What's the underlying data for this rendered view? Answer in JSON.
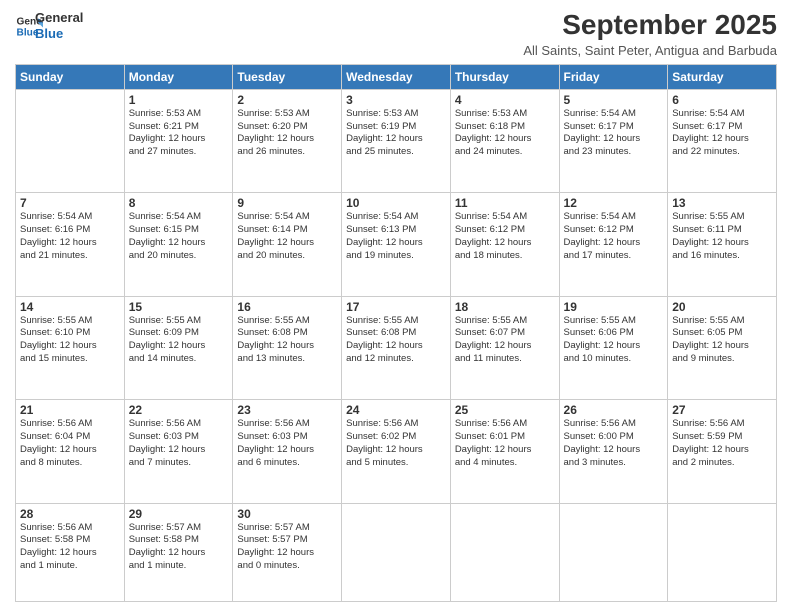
{
  "logo": {
    "line1": "General",
    "line2": "Blue"
  },
  "title": "September 2025",
  "subtitle": "All Saints, Saint Peter, Antigua and Barbuda",
  "days_header": [
    "Sunday",
    "Monday",
    "Tuesday",
    "Wednesday",
    "Thursday",
    "Friday",
    "Saturday"
  ],
  "weeks": [
    [
      {
        "day": "",
        "info": ""
      },
      {
        "day": "1",
        "info": "Sunrise: 5:53 AM\nSunset: 6:21 PM\nDaylight: 12 hours\nand 27 minutes."
      },
      {
        "day": "2",
        "info": "Sunrise: 5:53 AM\nSunset: 6:20 PM\nDaylight: 12 hours\nand 26 minutes."
      },
      {
        "day": "3",
        "info": "Sunrise: 5:53 AM\nSunset: 6:19 PM\nDaylight: 12 hours\nand 25 minutes."
      },
      {
        "day": "4",
        "info": "Sunrise: 5:53 AM\nSunset: 6:18 PM\nDaylight: 12 hours\nand 24 minutes."
      },
      {
        "day": "5",
        "info": "Sunrise: 5:54 AM\nSunset: 6:17 PM\nDaylight: 12 hours\nand 23 minutes."
      },
      {
        "day": "6",
        "info": "Sunrise: 5:54 AM\nSunset: 6:17 PM\nDaylight: 12 hours\nand 22 minutes."
      }
    ],
    [
      {
        "day": "7",
        "info": "Sunrise: 5:54 AM\nSunset: 6:16 PM\nDaylight: 12 hours\nand 21 minutes."
      },
      {
        "day": "8",
        "info": "Sunrise: 5:54 AM\nSunset: 6:15 PM\nDaylight: 12 hours\nand 20 minutes."
      },
      {
        "day": "9",
        "info": "Sunrise: 5:54 AM\nSunset: 6:14 PM\nDaylight: 12 hours\nand 20 minutes."
      },
      {
        "day": "10",
        "info": "Sunrise: 5:54 AM\nSunset: 6:13 PM\nDaylight: 12 hours\nand 19 minutes."
      },
      {
        "day": "11",
        "info": "Sunrise: 5:54 AM\nSunset: 6:12 PM\nDaylight: 12 hours\nand 18 minutes."
      },
      {
        "day": "12",
        "info": "Sunrise: 5:54 AM\nSunset: 6:12 PM\nDaylight: 12 hours\nand 17 minutes."
      },
      {
        "day": "13",
        "info": "Sunrise: 5:55 AM\nSunset: 6:11 PM\nDaylight: 12 hours\nand 16 minutes."
      }
    ],
    [
      {
        "day": "14",
        "info": "Sunrise: 5:55 AM\nSunset: 6:10 PM\nDaylight: 12 hours\nand 15 minutes."
      },
      {
        "day": "15",
        "info": "Sunrise: 5:55 AM\nSunset: 6:09 PM\nDaylight: 12 hours\nand 14 minutes."
      },
      {
        "day": "16",
        "info": "Sunrise: 5:55 AM\nSunset: 6:08 PM\nDaylight: 12 hours\nand 13 minutes."
      },
      {
        "day": "17",
        "info": "Sunrise: 5:55 AM\nSunset: 6:08 PM\nDaylight: 12 hours\nand 12 minutes."
      },
      {
        "day": "18",
        "info": "Sunrise: 5:55 AM\nSunset: 6:07 PM\nDaylight: 12 hours\nand 11 minutes."
      },
      {
        "day": "19",
        "info": "Sunrise: 5:55 AM\nSunset: 6:06 PM\nDaylight: 12 hours\nand 10 minutes."
      },
      {
        "day": "20",
        "info": "Sunrise: 5:55 AM\nSunset: 6:05 PM\nDaylight: 12 hours\nand 9 minutes."
      }
    ],
    [
      {
        "day": "21",
        "info": "Sunrise: 5:56 AM\nSunset: 6:04 PM\nDaylight: 12 hours\nand 8 minutes."
      },
      {
        "day": "22",
        "info": "Sunrise: 5:56 AM\nSunset: 6:03 PM\nDaylight: 12 hours\nand 7 minutes."
      },
      {
        "day": "23",
        "info": "Sunrise: 5:56 AM\nSunset: 6:03 PM\nDaylight: 12 hours\nand 6 minutes."
      },
      {
        "day": "24",
        "info": "Sunrise: 5:56 AM\nSunset: 6:02 PM\nDaylight: 12 hours\nand 5 minutes."
      },
      {
        "day": "25",
        "info": "Sunrise: 5:56 AM\nSunset: 6:01 PM\nDaylight: 12 hours\nand 4 minutes."
      },
      {
        "day": "26",
        "info": "Sunrise: 5:56 AM\nSunset: 6:00 PM\nDaylight: 12 hours\nand 3 minutes."
      },
      {
        "day": "27",
        "info": "Sunrise: 5:56 AM\nSunset: 5:59 PM\nDaylight: 12 hours\nand 2 minutes."
      }
    ],
    [
      {
        "day": "28",
        "info": "Sunrise: 5:56 AM\nSunset: 5:58 PM\nDaylight: 12 hours\nand 1 minute."
      },
      {
        "day": "29",
        "info": "Sunrise: 5:57 AM\nSunset: 5:58 PM\nDaylight: 12 hours\nand 1 minute."
      },
      {
        "day": "30",
        "info": "Sunrise: 5:57 AM\nSunset: 5:57 PM\nDaylight: 12 hours\nand 0 minutes."
      },
      {
        "day": "",
        "info": ""
      },
      {
        "day": "",
        "info": ""
      },
      {
        "day": "",
        "info": ""
      },
      {
        "day": "",
        "info": ""
      }
    ]
  ]
}
